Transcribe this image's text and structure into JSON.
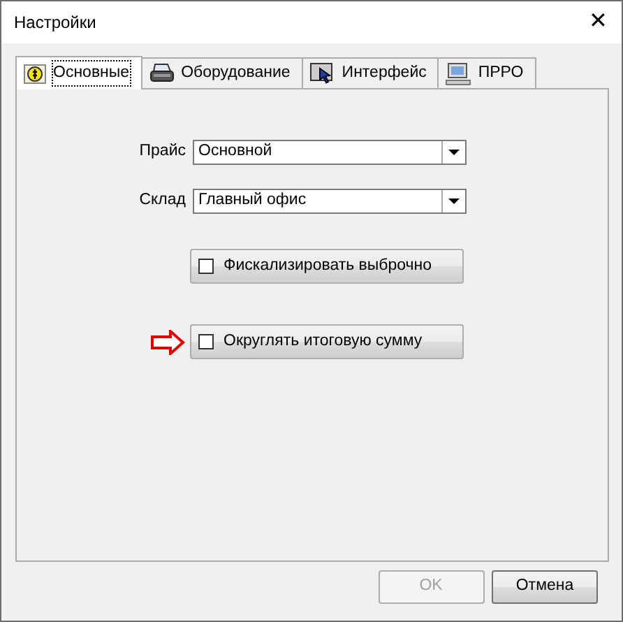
{
  "window": {
    "title": "Настройки",
    "close": "✕"
  },
  "tabs": [
    {
      "label": "Основные",
      "selected": true
    },
    {
      "label": "Оборудование",
      "selected": false
    },
    {
      "label": "Интерфейс",
      "selected": false
    },
    {
      "label": "ПРРО",
      "selected": false
    }
  ],
  "fields": [
    {
      "label": "Прайс",
      "value": "Основной"
    },
    {
      "label": "Склад",
      "value": "Главный офис"
    }
  ],
  "options": [
    {
      "label": "Фискализировать выброчно",
      "checked": false,
      "highlighted": false
    },
    {
      "label": "Округлять итоговую сумму",
      "checked": false,
      "highlighted": true
    }
  ],
  "buttons": [
    {
      "label": "OK",
      "disabled": true
    },
    {
      "label": "Отмена",
      "disabled": false
    }
  ]
}
